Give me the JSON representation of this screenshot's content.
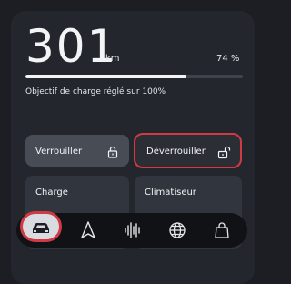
{
  "range": {
    "value": "301",
    "unit": "km",
    "battery_percent_label": "74 %",
    "battery_level": 0.74,
    "charge_target_text": "Objectif de charge réglé sur 100%"
  },
  "tiles": {
    "lock_label": "Verrouiller",
    "unlock_label": "Déverrouiller",
    "charge_label": "Charge",
    "climate_label": "Climatiseur"
  },
  "nav": {
    "items": [
      "car-icon",
      "navigation-arrow-icon",
      "audio-waveform-icon",
      "globe-icon",
      "shopping-bag-icon"
    ],
    "active_index": 0
  },
  "colors": {
    "highlight": "#d23945",
    "panel": "#23262d",
    "background": "#1c1e24"
  }
}
